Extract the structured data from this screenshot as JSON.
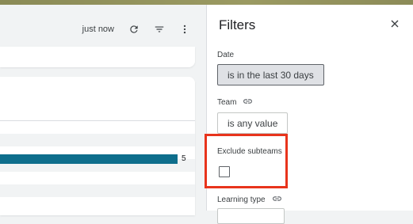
{
  "toolbar": {
    "updated_label": "just now",
    "refresh_icon": "refresh-icon",
    "filter_icon": "filter-list-icon",
    "more_icon": "more-vert-icon"
  },
  "chart_data": {
    "type": "bar",
    "orientation": "horizontal",
    "values": [
      5
    ],
    "bar_color": "#0e6e8c",
    "data_labels": [
      "5"
    ]
  },
  "filters": {
    "title": "Filters",
    "close_icon": "close-icon",
    "fields": {
      "date": {
        "label": "Date",
        "value": "is in the last 30 days",
        "active": true
      },
      "team": {
        "label": "Team",
        "value": "is any value",
        "link_icon": "link-icon"
      },
      "exclude_subteams": {
        "label": "Exclude subteams",
        "checked": false
      },
      "learning_type": {
        "label": "Learning type",
        "link_icon": "link-icon"
      }
    }
  },
  "colors": {
    "highlight": "#e8341c",
    "accent_bar": "#0e6e8c",
    "top_strip": "#9b9a62"
  }
}
